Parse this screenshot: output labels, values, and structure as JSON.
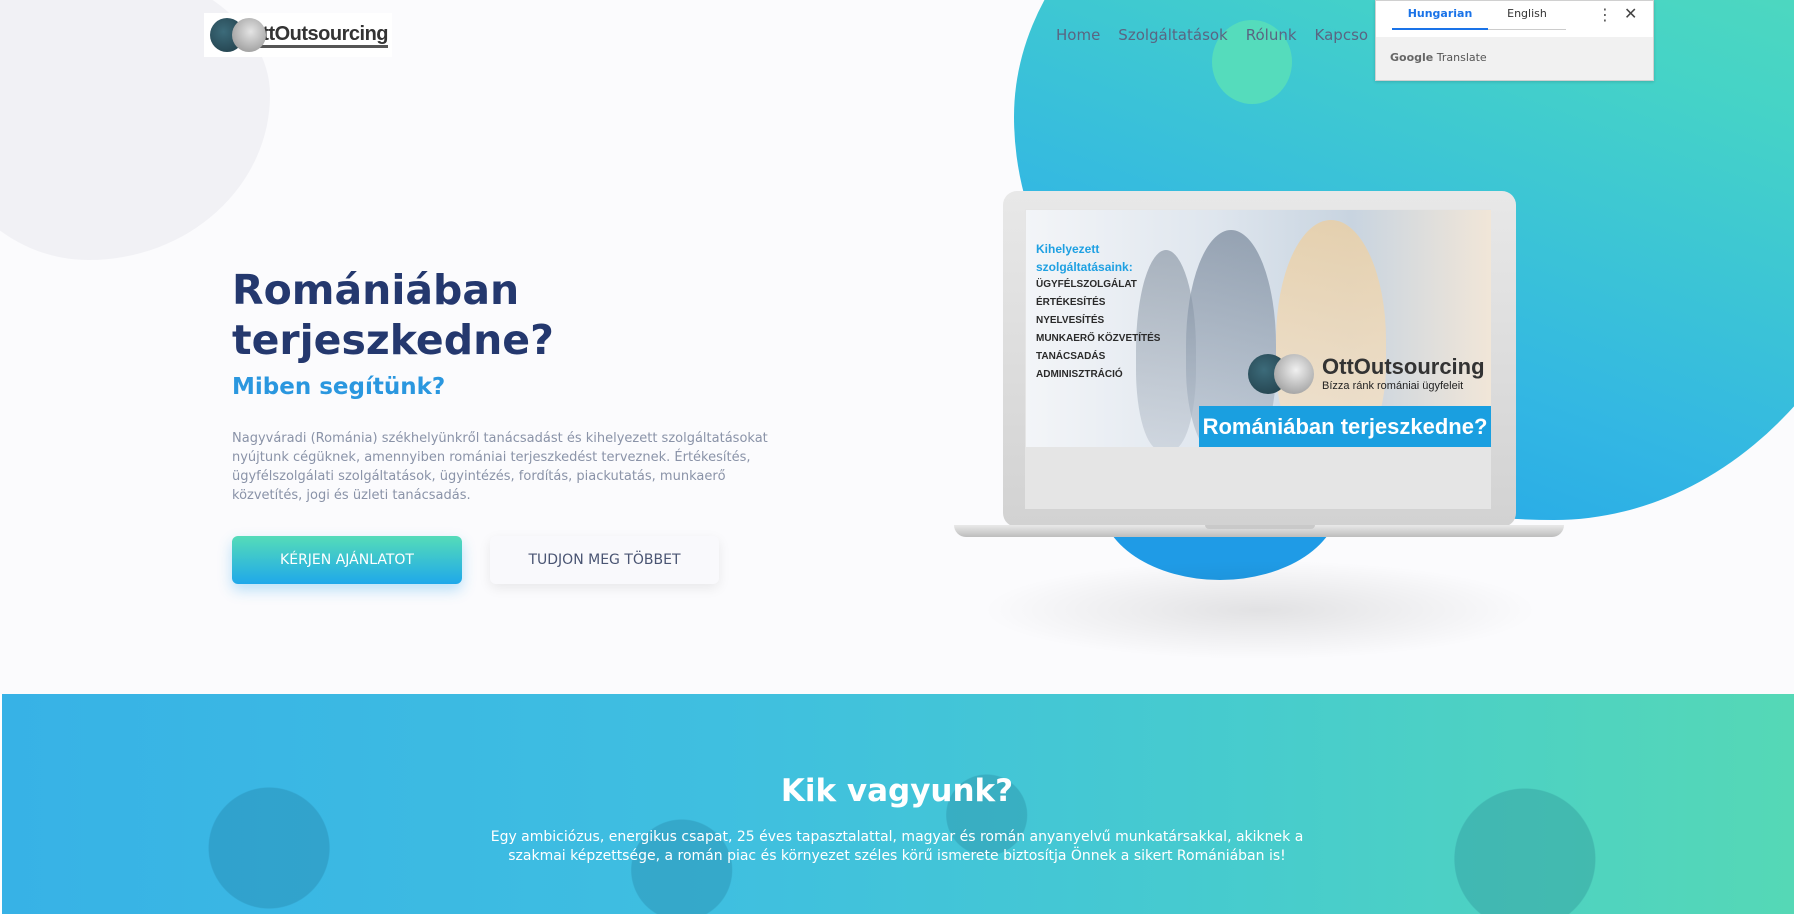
{
  "header": {
    "logo_text": "OttOutsourcing",
    "nav": [
      "Home",
      "Szolgáltatások",
      "Rólunk",
      "Kapcso"
    ]
  },
  "translate_widget": {
    "tabs": [
      "Hungarian",
      "English"
    ],
    "active_tab": "Hungarian",
    "brand": "Google",
    "brand_suffix": "Translate",
    "menu_icon": "more-vert-icon",
    "close_icon": "close-icon"
  },
  "hero": {
    "title": "Romániában terjeszkedne?",
    "subtitle": "Miben segítünk?",
    "lead": "Nagyváradi (Románia) székhelyünkről tanácsadást és kihelyezett szolgáltatásokat nyújtunk cégüknek, amennyiben romániai terjeszkedést terveznek. Értékesítés, ügyfélszolgálati szolgáltatások, ügyintézés, fordítás, piackutatás, munkaerő közvetítés, jogi és üzleti tanácsadás.",
    "primary_button": "KÉRJEN AJÁNLATOT",
    "secondary_button": "TUDJON MEG TÖBBET"
  },
  "banner": {
    "services_title": "Kihelyezett szolgáltatásaink:",
    "services": [
      "Ügyfélszolgálat",
      "Értékesítés",
      "Nyelvesítés",
      "Munkaerő közvetítés",
      "Tanácsadás",
      "Adminisztráció"
    ],
    "logo_text": "OttOutsourcing",
    "logo_slogan": "Bízza ránk romániai ügyfeleit",
    "bar_text": "Romániában terjeszkedne?"
  },
  "about": {
    "title": "Kik vagyunk?",
    "text": "Egy ambiciózus, energikus csapat, 25 éves tapasztalattal, magyar és román anyanyelvű munkatársakkal, akiknek a szakmai képzettsége, a román piac és környezet széles körű ismerete biztosítja Önnek a sikert Romániában is!"
  },
  "colors": {
    "title": "#24386e",
    "accent_blue": "#2a97df",
    "accent_green": "#55dcb8",
    "banner_blue": "#1a9fe0"
  }
}
